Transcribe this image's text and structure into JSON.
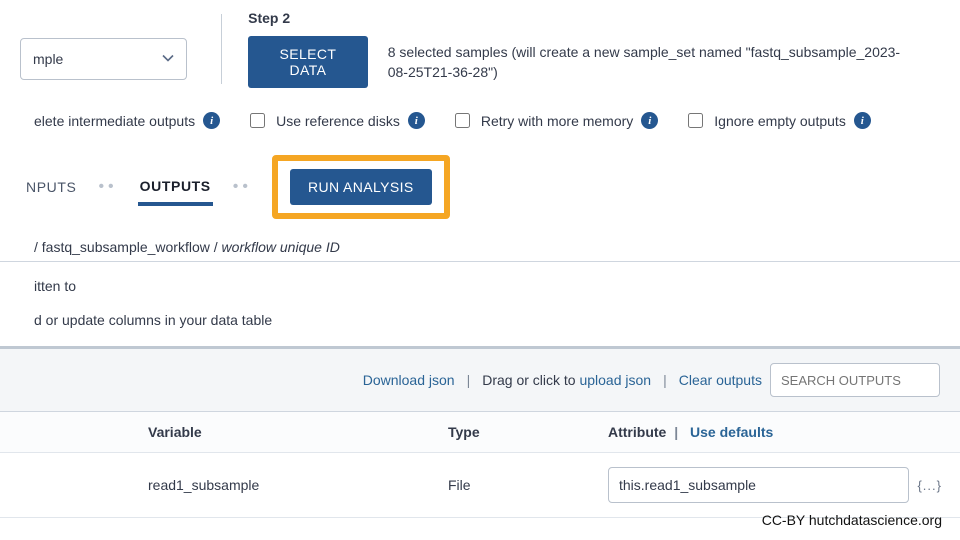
{
  "dropdown": {
    "value": "mple"
  },
  "step2": {
    "title": "Step 2",
    "button": "SELECT DATA",
    "desc": "8 selected samples (will create a new sample_set named \"fastq_subsample_2023-08-25T21-36-28\")"
  },
  "options": {
    "delete_intermediate": "elete intermediate outputs",
    "reference_disks": "Use reference disks",
    "retry_memory": "Retry with more memory",
    "ignore_empty": "Ignore empty outputs"
  },
  "tabs": {
    "inputs": "NPUTS",
    "outputs": "OUTPUTS",
    "run": "RUN ANALYSIS"
  },
  "crumb": {
    "slash1": " / ",
    "workflow": "fastq_subsample_workflow",
    "slash2": " / ",
    "unique": "workflow unique ID"
  },
  "body": {
    "written_to": "itten to",
    "update_cols": "d or update columns in your data table"
  },
  "panel_links": {
    "download_json": "Download json",
    "upload_prefix": "Drag or click to ",
    "upload_json": "upload json",
    "clear_outputs": "Clear outputs",
    "search_placeholder": "SEARCH OUTPUTS"
  },
  "table": {
    "headers": {
      "task": "",
      "variable": "Variable",
      "type": "Type",
      "attribute": "Attribute",
      "use_defaults": "Use defaults"
    },
    "rows": [
      {
        "variable": "read1_subsample",
        "type": "File",
        "attribute": "this.read1_subsample"
      }
    ]
  },
  "credit": "CC-BY  hutchdatascience.org"
}
